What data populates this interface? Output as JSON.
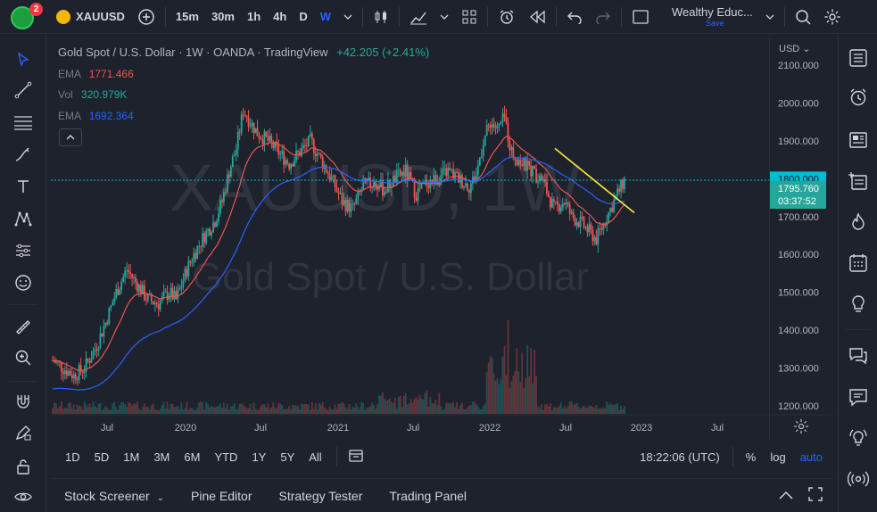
{
  "topbar": {
    "badge": "2",
    "symbol": "XAUUSD",
    "timeframes": [
      "15m",
      "30m",
      "1h",
      "4h",
      "D",
      "W"
    ],
    "active_timeframe": "W",
    "layout_name": "Wealthy Educ...",
    "layout_sub": "Save"
  },
  "legend": {
    "title": "Gold Spot / U.S. Dollar · 1W · OANDA · TradingView",
    "change": "+42.205 (+2.41%)",
    "indicators": [
      {
        "name": "EMA",
        "value": "1771.466",
        "color": "#ef5350"
      },
      {
        "name": "Vol",
        "value": "320.979K",
        "color": "#26a69a"
      },
      {
        "name": "EMA",
        "value": "1692.364",
        "color": "#2962ff"
      }
    ]
  },
  "watermark": {
    "symbol": "XAUUSD, 1W",
    "name": "Gold Spot / U.S. Dollar"
  },
  "price_axis": {
    "currency": "USD",
    "ticks": [
      "2100.000",
      "2000.000",
      "1900.000",
      "1800.000",
      "1700.000",
      "1600.000",
      "1500.000",
      "1400.000",
      "1300.000",
      "1200.000"
    ],
    "tag_level": "1800.000",
    "last_price": "1795.760",
    "countdown": "03:37:52"
  },
  "time_axis": {
    "labels": [
      "Jul",
      "2020",
      "Jul",
      "2021",
      "Jul",
      "2022",
      "Jul",
      "2023",
      "Jul"
    ]
  },
  "range_bar": {
    "buttons": [
      "1D",
      "5D",
      "1M",
      "3M",
      "6M",
      "YTD",
      "1Y",
      "5Y",
      "All"
    ],
    "clock": "18:22:06 (UTC)",
    "percent": "%",
    "log": "log",
    "auto": "auto"
  },
  "bottom_panel": {
    "tabs": [
      "Stock Screener",
      "Pine Editor",
      "Strategy Tester",
      "Trading Panel"
    ]
  },
  "colors": {
    "up": "#26a69a",
    "down": "#ef5350",
    "ema_fast": "#ef5350",
    "ema_slow": "#2962ff",
    "trendline": "#ffeb3b",
    "price_tag": "#26a69a",
    "level_tag": "#00bcd4",
    "accent": "#2962ff"
  }
}
